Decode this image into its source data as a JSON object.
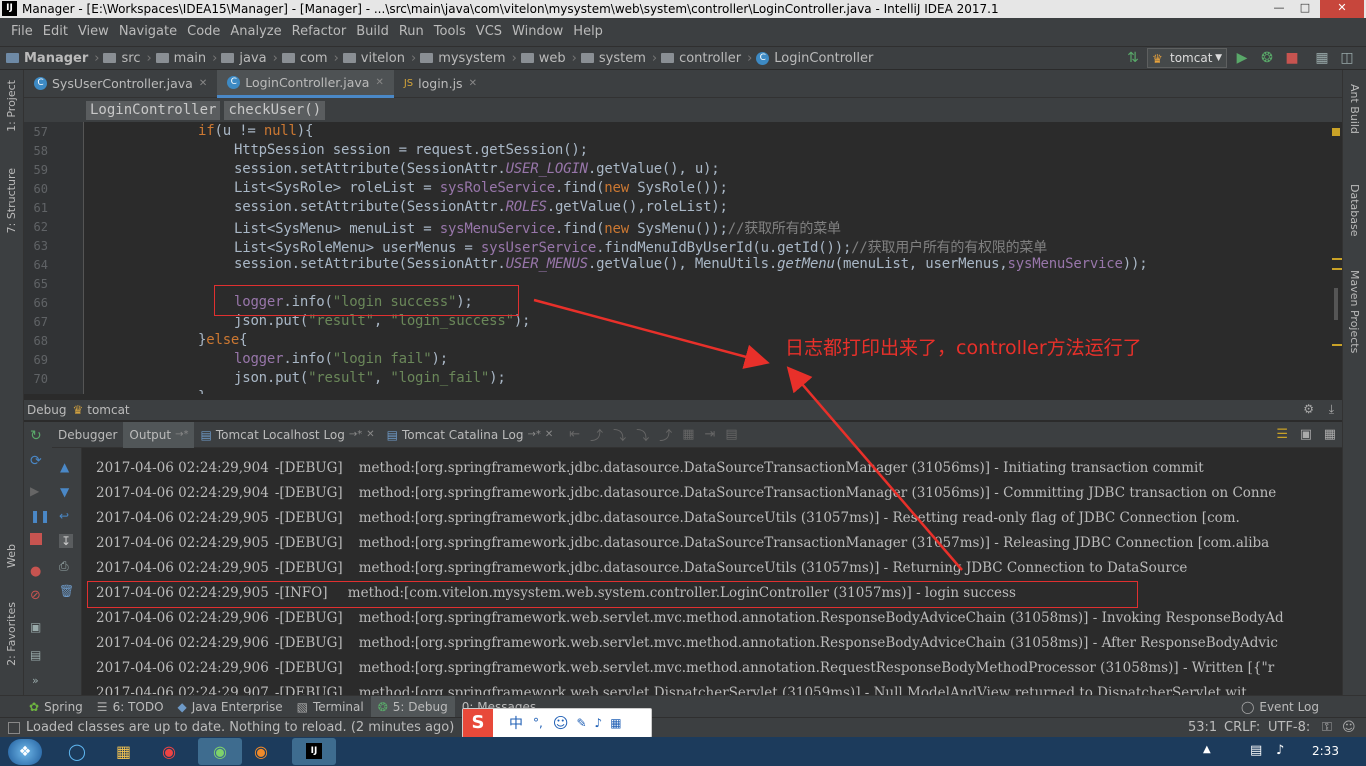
{
  "window": {
    "title": "Manager - [E:\\Workspaces\\IDEA15\\Manager] - [Manager] - ...\\src\\main\\java\\com\\vitelon\\mysystem\\web\\system\\controller\\LoginController.java - IntelliJ IDEA 2017.1",
    "app_icon": "IJ"
  },
  "menu": [
    "File",
    "Edit",
    "View",
    "Navigate",
    "Code",
    "Analyze",
    "Refactor",
    "Build",
    "Run",
    "Tools",
    "VCS",
    "Window",
    "Help"
  ],
  "breadcrumb": [
    "Manager",
    "src",
    "main",
    "java",
    "com",
    "vitelon",
    "mysystem",
    "web",
    "system",
    "controller",
    "LoginController"
  ],
  "run_config": "tomcat",
  "editor_tabs": [
    {
      "label": "SysUserController.java"
    },
    {
      "label": "LoginController.java"
    },
    {
      "label": "login.js"
    }
  ],
  "method_crumbs": [
    "LoginController",
    "checkUser()"
  ],
  "left_strip": [
    "1: Project",
    "7: Structure",
    "Web",
    "2: Favorites"
  ],
  "right_strip": [
    "Ant Build",
    "Database",
    "Maven Projects"
  ],
  "line_numbers": [
    "57",
    "58",
    "59",
    "60",
    "61",
    "62",
    "63",
    "64",
    "65",
    "66",
    "67",
    "68",
    "69",
    "70"
  ],
  "debug": {
    "label": "Debug",
    "config": "tomcat",
    "tabs": [
      "Debugger",
      "Output",
      "Tomcat Localhost Log",
      "Tomcat Catalina Log"
    ]
  },
  "log": [
    {
      "ts": "2017-04-06 02:24:29,904",
      "lvl": "-[DEBUG]",
      "msg": "method:[org.springframework.jdbc.datasource.DataSourceTransactionManager (31056ms)] - Initiating transaction commit"
    },
    {
      "ts": "2017-04-06 02:24:29,904",
      "lvl": "-[DEBUG]",
      "msg": "method:[org.springframework.jdbc.datasource.DataSourceTransactionManager (31056ms)] - Committing JDBC transaction on Conne"
    },
    {
      "ts": "2017-04-06 02:24:29,905",
      "lvl": "-[DEBUG]",
      "msg": "method:[org.springframework.jdbc.datasource.DataSourceUtils (31057ms)] - Resetting read-only flag of JDBC Connection [com."
    },
    {
      "ts": "2017-04-06 02:24:29,905",
      "lvl": "-[DEBUG]",
      "msg": "method:[org.springframework.jdbc.datasource.DataSourceTransactionManager (31057ms)] - Releasing JDBC Connection [com.aliba"
    },
    {
      "ts": "2017-04-06 02:24:29,905",
      "lvl": "-[DEBUG]",
      "msg": "method:[org.springframework.jdbc.datasource.DataSourceUtils (31057ms)] - Returning JDBC Connection to DataSource"
    },
    {
      "ts": "2017-04-06 02:24:29,905",
      "lvl": "-[INFO] ",
      "msg": "method:[com.vitelon.mysystem.web.system.controller.LoginController (31057ms)] - login success"
    },
    {
      "ts": "2017-04-06 02:24:29,906",
      "lvl": "-[DEBUG]",
      "msg": "method:[org.springframework.web.servlet.mvc.method.annotation.ResponseBodyAdviceChain (31058ms)] - Invoking ResponseBodyAd"
    },
    {
      "ts": "2017-04-06 02:24:29,906",
      "lvl": "-[DEBUG]",
      "msg": "method:[org.springframework.web.servlet.mvc.method.annotation.ResponseBodyAdviceChain (31058ms)] - After ResponseBodyAdvic"
    },
    {
      "ts": "2017-04-06 02:24:29,906",
      "lvl": "-[DEBUG]",
      "msg": "method:[org.springframework.web.servlet.mvc.method.annotation.RequestResponseBodyMethodProcessor (31058ms)] - Written [{\"r"
    },
    {
      "ts": "2017-04-06 02:24:29,907",
      "lvl": "-[DEBUG]",
      "msg": "method:[org.springframework.web.servlet.DispatcherServlet (31059ms)] - Null ModelAndView returned to DispatcherServlet wit"
    }
  ],
  "annotation": "日志都打印出来了，controller方法运行了",
  "bottom_tabs": [
    "Spring",
    "6: TODO",
    "Java Enterprise",
    "Terminal",
    "5: Debug",
    "0: Messages",
    "Event Log"
  ],
  "status": {
    "message": "Loaded classes are up to date. Nothing to reload. (2 minutes ago)",
    "position": "53:1",
    "line_sep": "CRLF:",
    "encoding": "UTF-8:"
  },
  "taskbar": {
    "time": "2:33"
  },
  "ime": {
    "logo": "S",
    "lang": "中"
  },
  "colors": {
    "accent": "#4a88c7",
    "annotation": "#e8302a",
    "keyword": "#cc7832",
    "string": "#6a8759",
    "field": "#9876aa"
  }
}
